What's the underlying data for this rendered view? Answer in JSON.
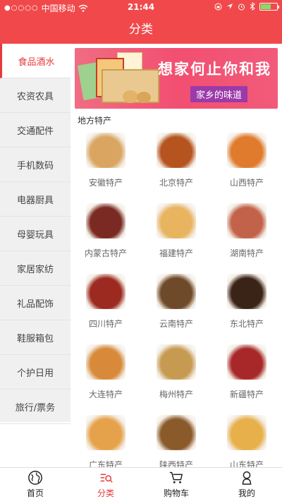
{
  "status_bar": {
    "carrier": "中国移动",
    "time": "21:44",
    "signal_dots": "●○○○○"
  },
  "nav": {
    "title": "分类"
  },
  "sidebar": {
    "items": [
      {
        "label": "食品酒水",
        "active": true
      },
      {
        "label": "农资农具",
        "active": false
      },
      {
        "label": "交通配件",
        "active": false
      },
      {
        "label": "手机数码",
        "active": false
      },
      {
        "label": "电器厨具",
        "active": false
      },
      {
        "label": "母婴玩具",
        "active": false
      },
      {
        "label": "家居家纺",
        "active": false
      },
      {
        "label": "礼品配饰",
        "active": false
      },
      {
        "label": "鞋服箱包",
        "active": false
      },
      {
        "label": "个护日用",
        "active": false
      },
      {
        "label": "旅行/票务",
        "active": false
      }
    ]
  },
  "banner": {
    "title": "想家何止你和我",
    "tag": "家乡的味道"
  },
  "section": {
    "title": "地方特产"
  },
  "products": [
    {
      "label": "安徽特产",
      "color": "#d9a560"
    },
    {
      "label": "北京特产",
      "color": "#b5541f"
    },
    {
      "label": "山西特产",
      "color": "#e07a2c"
    },
    {
      "label": "内蒙古特产",
      "color": "#7a2a22"
    },
    {
      "label": "福建特产",
      "color": "#e8b460"
    },
    {
      "label": "湖南特产",
      "color": "#c2624a"
    },
    {
      "label": "四川特产",
      "color": "#9c2a20"
    },
    {
      "label": "云南特产",
      "color": "#6e4a2a"
    },
    {
      "label": "东北特产",
      "color": "#3a2418"
    },
    {
      "label": "大连特产",
      "color": "#d88a3a"
    },
    {
      "label": "梅州特产",
      "color": "#c79a52"
    },
    {
      "label": "新疆特产",
      "color": "#a8282a"
    },
    {
      "label": "广东特产",
      "color": "#e6a24a"
    },
    {
      "label": "陕西特产",
      "color": "#8a5a2a"
    },
    {
      "label": "山东特产",
      "color": "#e7b04a"
    }
  ],
  "tabbar": {
    "items": [
      {
        "label": "首页",
        "icon": "globe-icon",
        "active": false
      },
      {
        "label": "分类",
        "icon": "category-search-icon",
        "active": true
      },
      {
        "label": "购物车",
        "icon": "cart-icon",
        "active": false
      },
      {
        "label": "我的",
        "icon": "person-icon",
        "active": false
      }
    ]
  },
  "colors": {
    "brand": "#f1494b",
    "active_text": "#e8383a"
  }
}
